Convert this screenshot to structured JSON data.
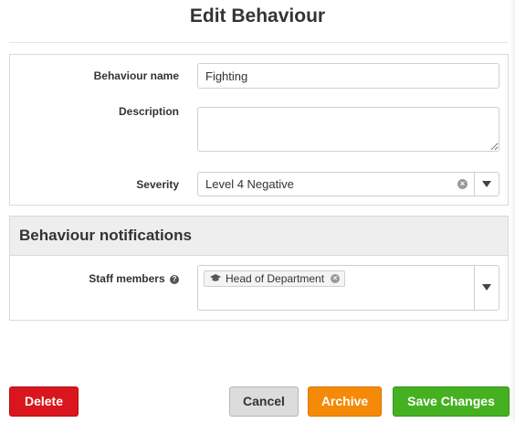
{
  "dialog": {
    "title": "Edit Behaviour"
  },
  "form": {
    "name_label": "Behaviour name",
    "name_value": "Fighting",
    "description_label": "Description",
    "description_value": "",
    "severity_label": "Severity",
    "severity_value": "Level 4 Negative",
    "severity_clear_icon": "clear-circle-icon",
    "dropdown_icon": "caret-down-icon"
  },
  "notifications": {
    "header": "Behaviour notifications",
    "staff_label": "Staff members",
    "help_icon": "question-circle-icon",
    "selected": [
      {
        "label": "Head of Department",
        "icon": "graduation-cap-icon"
      }
    ]
  },
  "buttons": {
    "delete": "Delete",
    "cancel": "Cancel",
    "archive": "Archive",
    "save": "Save Changes"
  },
  "colors": {
    "delete": "#d9161d",
    "cancel": "#dcdcdc",
    "archive": "#f58a08",
    "save": "#45b121",
    "section_header": "#eeeeee"
  }
}
